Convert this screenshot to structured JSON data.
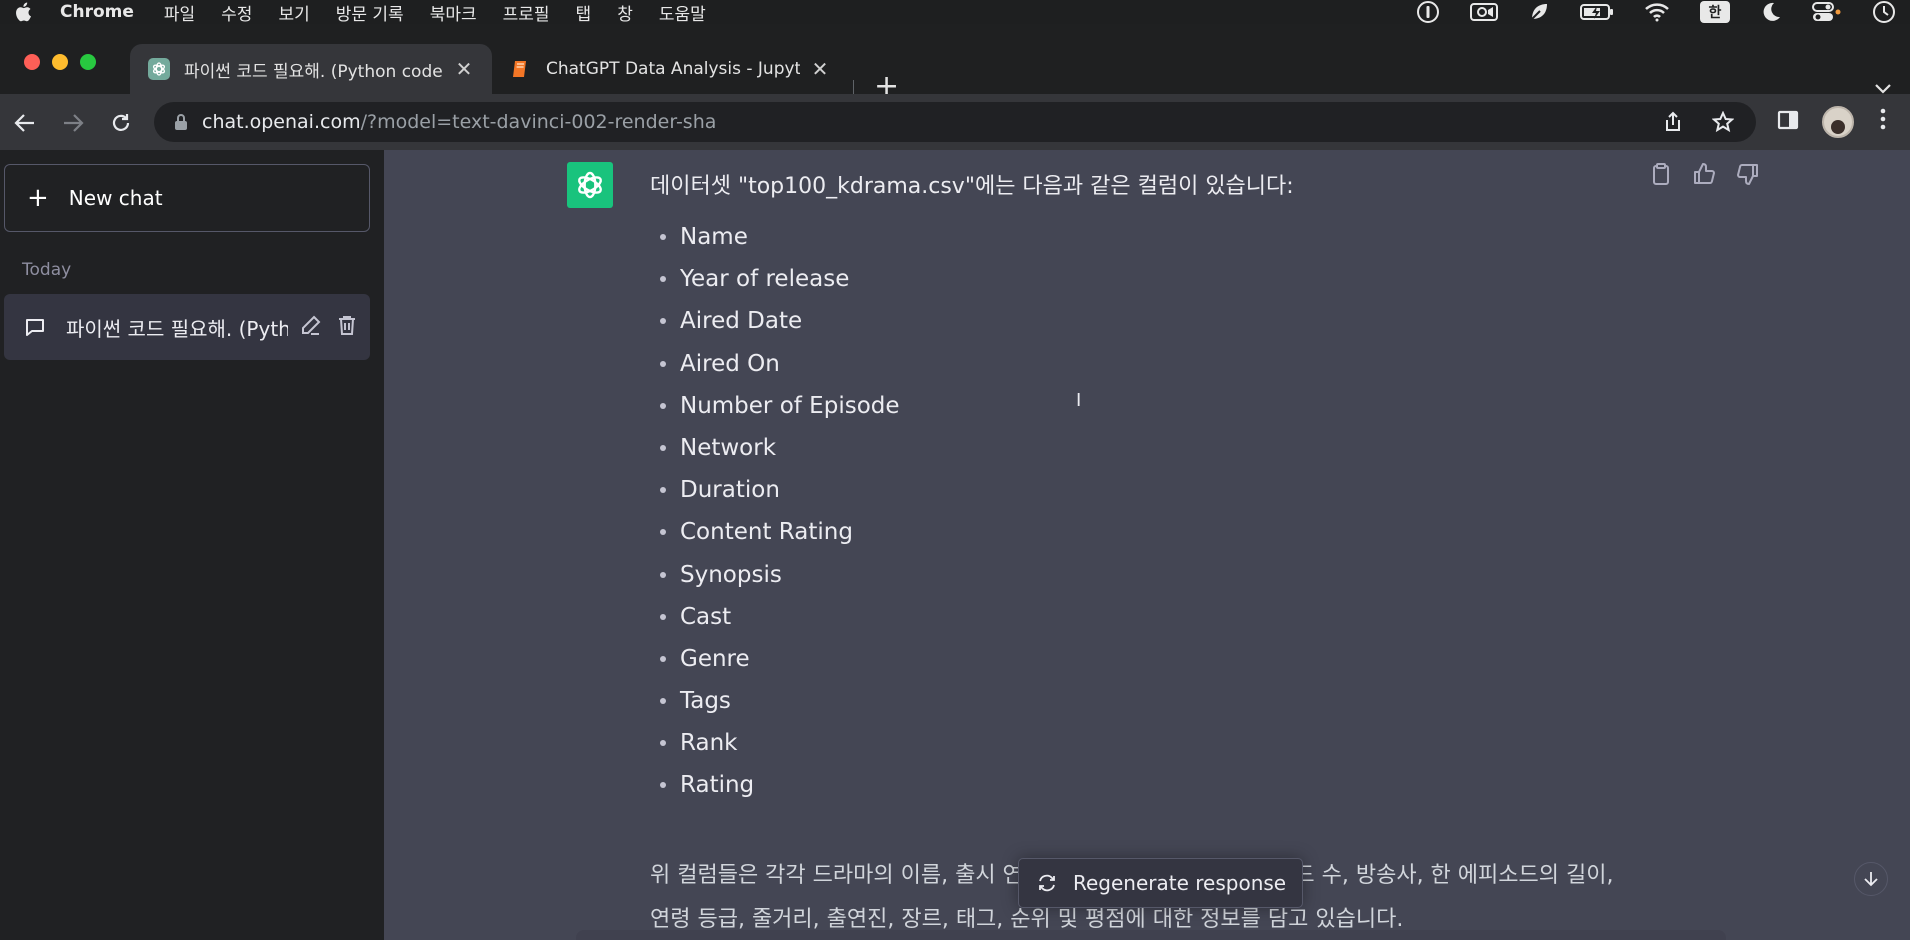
{
  "menubar": {
    "app_name": "Chrome",
    "items": [
      "파일",
      "수정",
      "보기",
      "방문 기록",
      "북마크",
      "프로필",
      "탭",
      "창",
      "도움말"
    ],
    "input_source": "한"
  },
  "tabs": [
    {
      "title": "파이썬 코드 필요해. (Python code",
      "favicon": "openai-icon",
      "active": true
    },
    {
      "title": "ChatGPT Data Analysis - Jupyter",
      "favicon": "jupyter-book-icon",
      "active": false
    }
  ],
  "address": {
    "host": "chat.openai.com",
    "path": "/?model=text-davinci-002-render-sha"
  },
  "sidebar": {
    "new_chat_label": "New chat",
    "section_label": "Today",
    "conversations": [
      {
        "label": "파이썬 코드 필요해. (Python"
      }
    ]
  },
  "message": {
    "intro": "데이터셋 \"top100_kdrama.csv\"에는 다음과 같은 컬럼이 있습니다:",
    "columns": [
      "Name",
      "Year of release",
      "Aired Date",
      "Aired On",
      "Number of Episode",
      "Network",
      "Duration",
      "Content Rating",
      "Synopsis",
      "Cast",
      "Genre",
      "Tags",
      "Rank",
      "Rating"
    ],
    "summary": "위 컬럼들은 각각 드라마의 이름, 출시 연도, 방영일, 방영 요일, 에피소드 수, 방송사, 한 에피소드의 길이, 연령 등급, 줄거리, 출연진, 장르, 태그, 순위 및 평점에 대한 정보를 담고 있습니다."
  },
  "regenerate_label": "Regenerate response",
  "colors": {
    "sidebar_bg": "#202123",
    "main_bg": "#444654",
    "assistant_avatar": "#19c37d"
  }
}
